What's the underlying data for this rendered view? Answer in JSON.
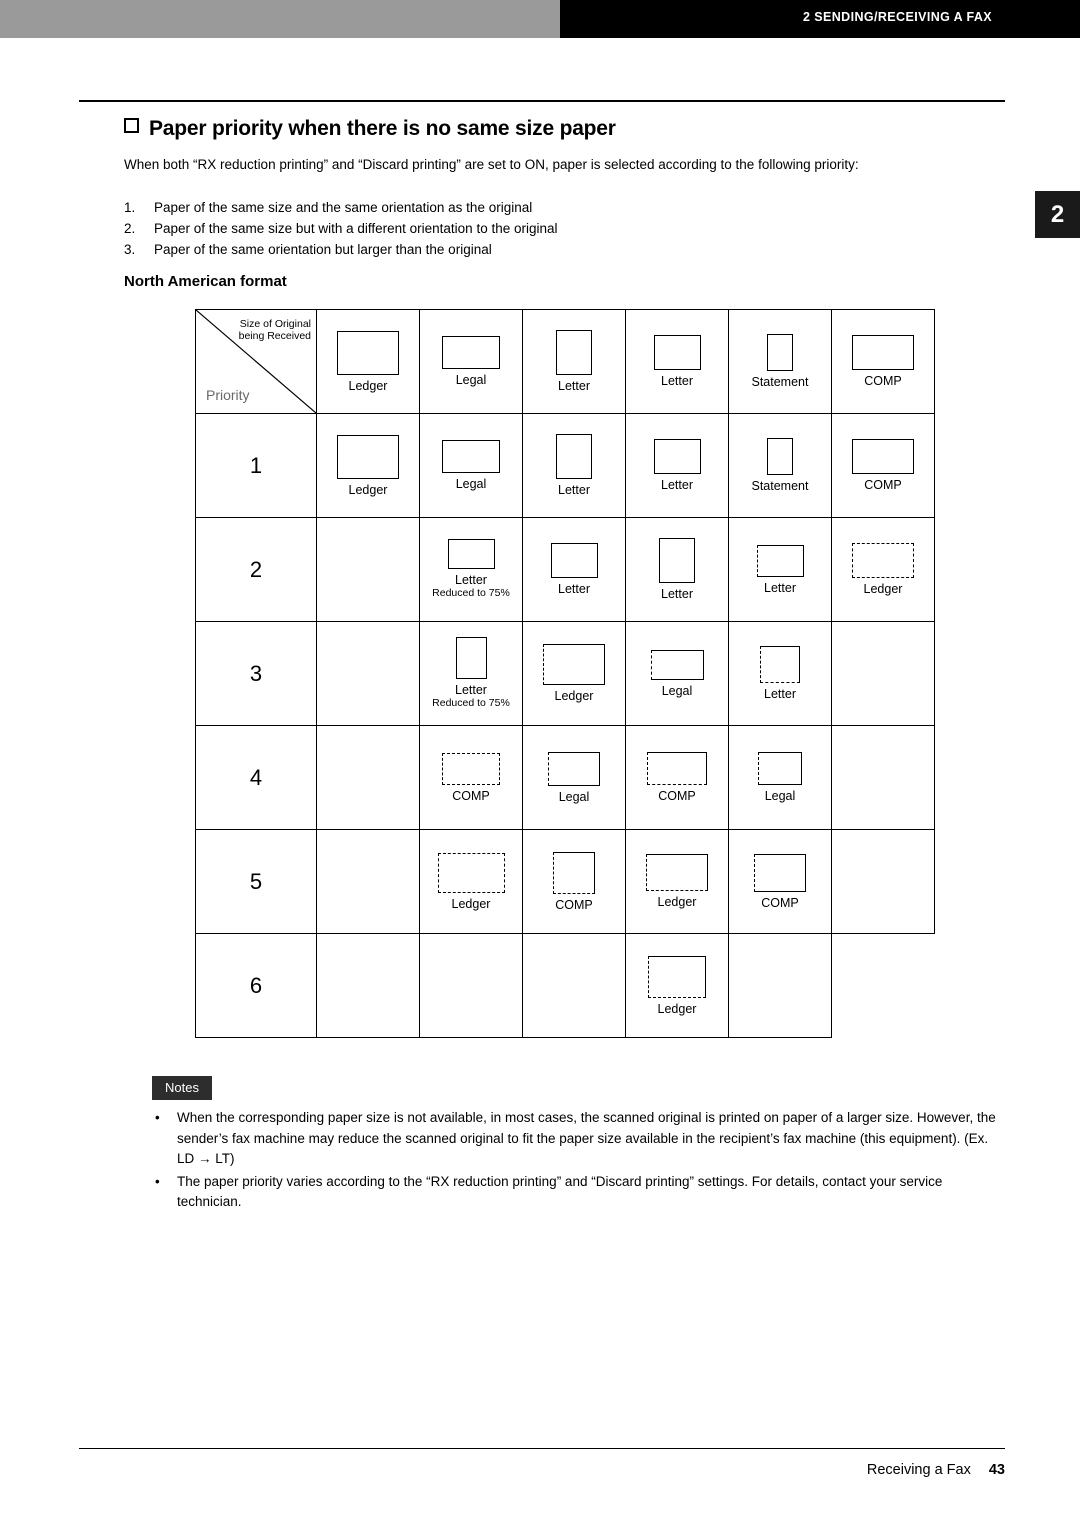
{
  "header": {
    "running_head": "2 SENDING/RECEIVING A FAX",
    "chapter_tab": "2"
  },
  "title": "Paper priority when there is no same size paper",
  "intro": "When both “RX reduction printing” and “Discard printing” are set to ON, paper is selected according to the following priority:",
  "priority_list": [
    {
      "n": "1.",
      "text": "Paper of the same size and the same orientation as the original"
    },
    {
      "n": "2.",
      "text": "Paper of the same size but with a different orientation to the original"
    },
    {
      "n": "3.",
      "text": "Paper of the same orientation but larger than the original"
    }
  ],
  "subtitle": "North American format",
  "table": {
    "corner_label_top": "Size of Original\nbeing Received",
    "corner_label_bottom": "Priority",
    "column_headers": [
      "Ledger",
      "Legal",
      "Letter",
      "Letter",
      "Statement",
      "COMP"
    ],
    "row_labels": [
      "1",
      "2",
      "3",
      "4",
      "5",
      "6"
    ],
    "rows": [
      [
        "Ledger",
        "Legal",
        "Letter",
        "Letter",
        "Statement",
        "COMP"
      ],
      [
        "",
        "Letter",
        "Letter",
        "Letter",
        "Letter",
        "Ledger"
      ],
      [
        "",
        "Letter",
        "Ledger",
        "Legal",
        "Letter",
        ""
      ],
      [
        "",
        "COMP",
        "Legal",
        "COMP",
        "Legal",
        ""
      ],
      [
        "",
        "Ledger",
        "COMP",
        "Ledger",
        "COMP",
        ""
      ],
      [
        "",
        "",
        "",
        "",
        "Ledger",
        ""
      ]
    ],
    "sublabels": {
      "r2c2": "Reduced to 75%",
      "r3c2": "Reduced to 75%"
    }
  },
  "notes": {
    "tag": "Notes",
    "items": [
      "When the corresponding paper size is not available, in most cases, the scanned original is printed on paper of a larger size. However, the sender’s fax machine may reduce the scanned original to fit the paper size available in the recipient’s fax machine (this equipment). (Ex. LD → LT)",
      "The paper priority varies according to the “RX reduction printing” and “Discard printing” settings. For details, contact your service technician."
    ]
  },
  "footer": {
    "section": "Receiving a Fax",
    "page": "43"
  }
}
